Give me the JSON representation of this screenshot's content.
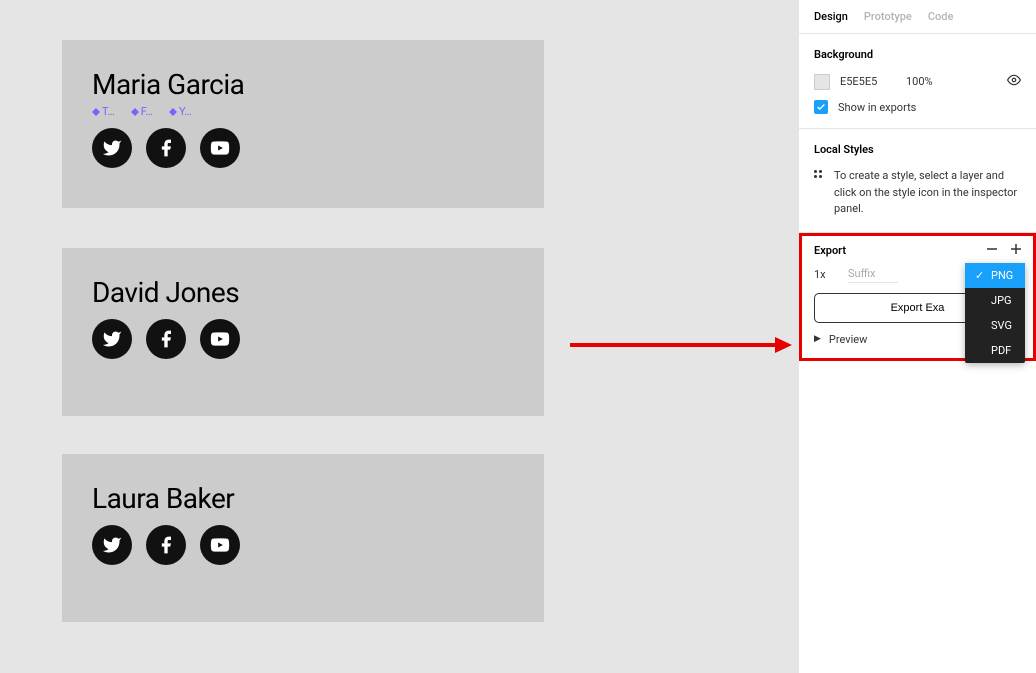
{
  "canvas": {
    "cards": [
      {
        "name": "Maria Garcia",
        "labels": [
          "T…",
          "F…",
          "Y…"
        ],
        "showLabels": true
      },
      {
        "name": "David Jones",
        "labels": [],
        "showLabels": false
      },
      {
        "name": "Laura Baker",
        "labels": [],
        "showLabels": false
      }
    ]
  },
  "panel": {
    "tabs": {
      "design": "Design",
      "prototype": "Prototype",
      "code": "Code"
    },
    "background": {
      "title": "Background",
      "hex": "E5E5E5",
      "opacity": "100%",
      "showInExports": "Show in exports"
    },
    "localStyles": {
      "title": "Local Styles",
      "text": "To create a style, select a layer and click on the style icon in the inspector panel."
    },
    "export": {
      "title": "Export",
      "scale": "1x",
      "suffixPlaceholder": "Suffix",
      "selected": "PNG",
      "options": [
        "PNG",
        "JPG",
        "SVG",
        "PDF"
      ],
      "button": "Export Exa",
      "preview": "Preview"
    }
  },
  "colors": {
    "accent": "#18a0fb",
    "annotation": "#e60000",
    "component": "#7b61ff"
  }
}
